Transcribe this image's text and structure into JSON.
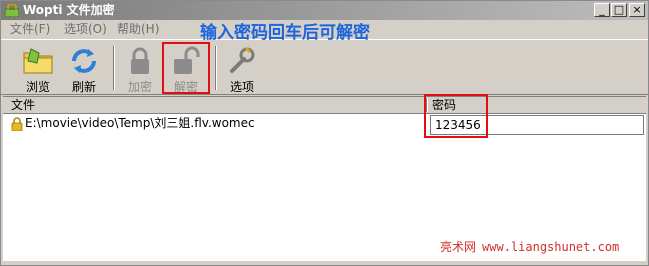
{
  "window": {
    "title": "Wopti 文件加密"
  },
  "menubar": {
    "items": [
      "文件(F)",
      "选项(O)",
      "帮助(H)"
    ]
  },
  "toolbar": {
    "browse": "浏览",
    "refresh": "刷新",
    "encrypt": "加密",
    "decrypt": "解密",
    "options": "选项"
  },
  "annotation": "输入密码回车后可解密",
  "list": {
    "columns": [
      "文件",
      "密码"
    ],
    "rows": [
      {
        "file": "E:\\movie\\video\\Temp\\刘三姐.flv.womec",
        "password": "123456"
      }
    ]
  },
  "watermark": {
    "site": "亮术网",
    "url": "www.liangshunet.com"
  },
  "colors": {
    "annotation": "#1e64dc",
    "highlight_box": "#e01010",
    "watermark": "#d0302c"
  }
}
